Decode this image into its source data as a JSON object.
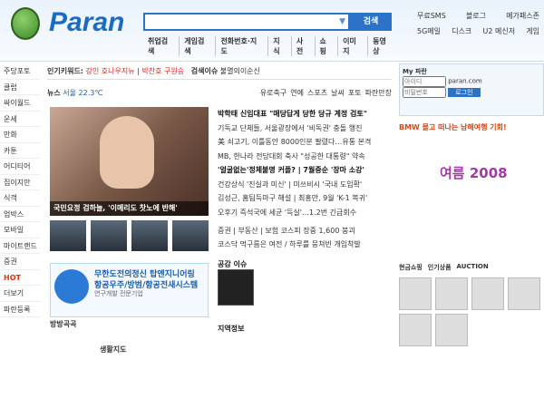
{
  "header": {
    "logo": "Paran",
    "search_button": "검색",
    "subnav": [
      "취업검색",
      "게임검색",
      "전화번호·지도",
      "지식",
      "사전",
      "쇼핑",
      "이미지",
      "동영상"
    ],
    "right_links_row1": [
      "무료SMS",
      "블로그",
      "메가패스존"
    ],
    "right_links_row2": [
      "5G메일",
      "디스크",
      "U2 메신저",
      "게임"
    ]
  },
  "left_menu": [
    "주당포토",
    "클럽",
    "싸이월드",
    "운세",
    "만화",
    "카툰",
    "어디티어",
    "집이지만",
    "식객",
    "업박스",
    "모바일",
    "마이트랜드",
    "증권",
    "HOT",
    "더보기",
    "파란등록"
  ],
  "keywords": {
    "label": "인기키워드:",
    "item1": "강인 호나우지뉴",
    "item2": "박찬호 구원승",
    "label2": "검색이슈",
    "item3": "불멸의이순신"
  },
  "news_tabs": {
    "label": "뉴스",
    "weather": "서울 22.3℃",
    "tabs": [
      "유로축구",
      "연예",
      "스포츠",
      "날씨",
      "포토",
      "파란만장"
    ]
  },
  "headline_caption": "국민요정 검하늘, '이메리도 찻노에 반해'",
  "headlines": [
    "박학태 신임대표 \"매당답게 당한 당규 계정 검토\"",
    "기독교 단체들, 서울광장에서 '비독권' 충돌 행진",
    "美 쇠고기, 이틀동안 8000인분 팔렸다…유통 본격",
    "MB, 한나라 전당대회 축사 \"성공한 대통령\" 약속",
    "'얼굴없는'정체불명 커플? | 7월중순 '장마 소강'",
    "건강상식 '진실과 미신' | 미쓰비시 '국내 도입확'",
    "김성근, 홈팀득마구 해설 | 최홍만, 9월 'K-1 복귀'",
    "오후기 즉석국에 세균 '득실'…1.2번 긴급회수"
  ],
  "mid_info": [
    "증권 | 부동산 | 보험  코스피 장중 1,600 붕괴",
    "코스닥 먹구름은 여전 / 하루를 뭉쳐빈 개입착발"
  ],
  "card": {
    "title": "무한도전의정신 탑엔지니어링",
    "subtitle": "항공우주/방범/항공전새시스템",
    "desc": "연구개발 전문기업"
  },
  "sections": {
    "dance": "공감 이슈",
    "local": "지역정보",
    "travel": "방방곡곡",
    "realty": "생활지도"
  },
  "right": {
    "my_title": "My 파란",
    "login_label": "로그인",
    "id_placeholder": "아이디",
    "pw_placeholder": "비밀번호",
    "domain": "paran.com",
    "ad": "BMW 몰고 떠나는 남해여행 기회!",
    "promo": "여름 2008",
    "shop_tabs": [
      "현금쇼핑",
      "인기상품",
      "AUCTION"
    ]
  }
}
